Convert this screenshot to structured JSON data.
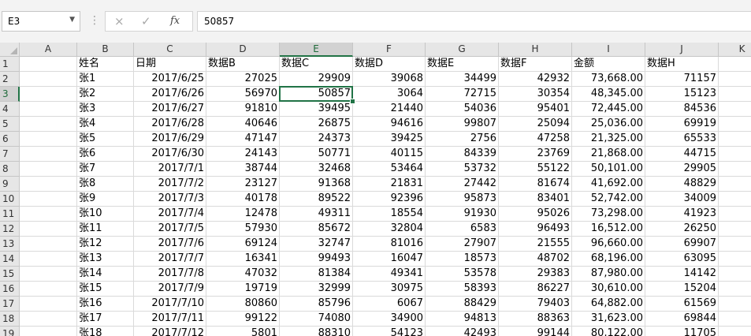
{
  "formula_bar": {
    "name_box": "E3",
    "cancel_icon": "×",
    "enter_icon": "✓",
    "fx_label": "fx",
    "formula_value": "50857"
  },
  "columns": [
    "A",
    "B",
    "C",
    "D",
    "E",
    "F",
    "G",
    "H",
    "I",
    "J",
    "K"
  ],
  "selected": {
    "column": "E",
    "row": "3"
  },
  "header_row": [
    "",
    "姓名",
    "日期",
    "数据B",
    "数据C",
    "数据D",
    "数据E",
    "数据F",
    "金额",
    "数据H"
  ],
  "rows": [
    [
      "张1",
      "2017/6/25",
      "27025",
      "29909",
      "39068",
      "34499",
      "42932",
      "73,668.00",
      "71157"
    ],
    [
      "张2",
      "2017/6/26",
      "56970",
      "50857",
      "3064",
      "72715",
      "30354",
      "48,345.00",
      "15123"
    ],
    [
      "张3",
      "2017/6/27",
      "91810",
      "39495",
      "21440",
      "54036",
      "95401",
      "72,445.00",
      "84536"
    ],
    [
      "张4",
      "2017/6/28",
      "40646",
      "26875",
      "94616",
      "99807",
      "25094",
      "25,036.00",
      "69919"
    ],
    [
      "张5",
      "2017/6/29",
      "47147",
      "24373",
      "39425",
      "2756",
      "47258",
      "21,325.00",
      "65533"
    ],
    [
      "张6",
      "2017/6/30",
      "24143",
      "50771",
      "40115",
      "84339",
      "23769",
      "21,868.00",
      "44715"
    ],
    [
      "张7",
      "2017/7/1",
      "38744",
      "32468",
      "53464",
      "53732",
      "55122",
      "50,101.00",
      "29905"
    ],
    [
      "张8",
      "2017/7/2",
      "23127",
      "91368",
      "21831",
      "27442",
      "81674",
      "41,692.00",
      "48829"
    ],
    [
      "张9",
      "2017/7/3",
      "40178",
      "89522",
      "92396",
      "95873",
      "83401",
      "52,742.00",
      "34009"
    ],
    [
      "张10",
      "2017/7/4",
      "12478",
      "49311",
      "18554",
      "91930",
      "95026",
      "73,298.00",
      "41923"
    ],
    [
      "张11",
      "2017/7/5",
      "57930",
      "85672",
      "32804",
      "6583",
      "96493",
      "16,512.00",
      "26250"
    ],
    [
      "张12",
      "2017/7/6",
      "69124",
      "32747",
      "81016",
      "27907",
      "21555",
      "96,660.00",
      "69907"
    ],
    [
      "张13",
      "2017/7/7",
      "16341",
      "99493",
      "16047",
      "18573",
      "48702",
      "68,196.00",
      "63095"
    ],
    [
      "张14",
      "2017/7/8",
      "47032",
      "81384",
      "49341",
      "53578",
      "29383",
      "87,980.00",
      "14142"
    ],
    [
      "张15",
      "2017/7/9",
      "19719",
      "32999",
      "30975",
      "58393",
      "86227",
      "30,610.00",
      "15204"
    ],
    [
      "张16",
      "2017/7/10",
      "80860",
      "85796",
      "6067",
      "88429",
      "79403",
      "64,882.00",
      "61569"
    ],
    [
      "张17",
      "2017/7/11",
      "99122",
      "74080",
      "34900",
      "94813",
      "88363",
      "31,623.00",
      "69844"
    ],
    [
      "张18",
      "2017/7/12",
      "5801",
      "88310",
      "54123",
      "42493",
      "99144",
      "80,122.00",
      "11705"
    ]
  ],
  "colors": {
    "selection": "#217346",
    "header_bg": "#e6e6e6",
    "header_selected_bg": "#d2d2d2"
  },
  "icons": {
    "cancel": "close-icon",
    "enter": "check-icon",
    "fx": "function-icon",
    "name_box_dropdown": "chevron-down-icon"
  }
}
